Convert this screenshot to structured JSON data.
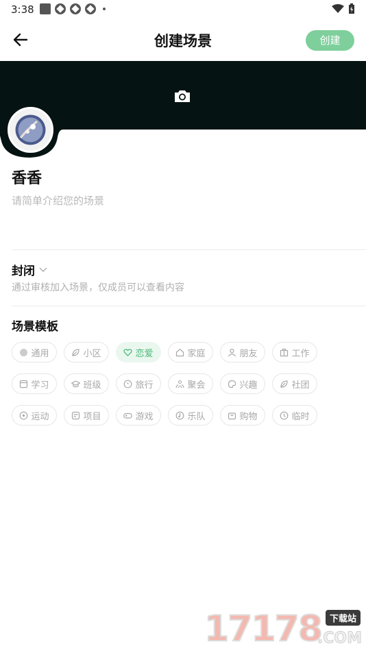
{
  "status_bar": {
    "time": "3:38"
  },
  "header": {
    "title": "创建场景",
    "create_label": "创建"
  },
  "scene": {
    "name": "香香",
    "description_placeholder": "请简单介绍您的场景"
  },
  "privacy": {
    "label": "封闭",
    "description": "通过审核加入场景，仅成员可以查看内容"
  },
  "templates": {
    "title": "场景模板",
    "items": [
      {
        "label": "通用",
        "icon": "dot-icon"
      },
      {
        "label": "小区",
        "icon": "leaf-icon"
      },
      {
        "label": "恋爱",
        "icon": "heart-icon",
        "active": true
      },
      {
        "label": "家庭",
        "icon": "home-icon"
      },
      {
        "label": "朋友",
        "icon": "user-icon"
      },
      {
        "label": "工作",
        "icon": "briefcase-icon"
      },
      {
        "label": "学习",
        "icon": "book-icon"
      },
      {
        "label": "班级",
        "icon": "graduation-icon"
      },
      {
        "label": "旅行",
        "icon": "compass-icon"
      },
      {
        "label": "聚会",
        "icon": "group-icon"
      },
      {
        "label": "兴趣",
        "icon": "palette-icon"
      },
      {
        "label": "社团",
        "icon": "leaf-icon"
      },
      {
        "label": "运动",
        "icon": "ball-icon"
      },
      {
        "label": "项目",
        "icon": "project-icon"
      },
      {
        "label": "游戏",
        "icon": "gamepad-icon"
      },
      {
        "label": "乐队",
        "icon": "music-icon"
      },
      {
        "label": "购物",
        "icon": "bag-icon"
      },
      {
        "label": "临时",
        "icon": "clock-icon"
      }
    ]
  },
  "watermark": {
    "number": "17178",
    "tag": "下载站",
    "suffix": ".COM"
  },
  "colors": {
    "accent": "#7ecf9b",
    "active_chip_bg": "#eaf7ef",
    "active_chip_text": "#4cb97a",
    "cover_bg": "#061313"
  }
}
